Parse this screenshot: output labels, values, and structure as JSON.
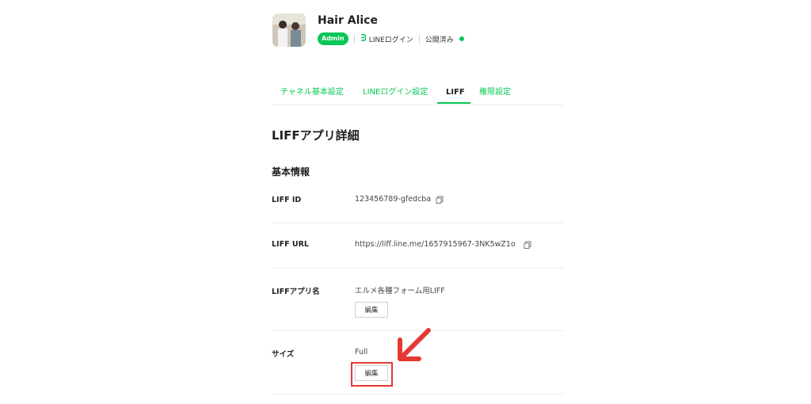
{
  "channel": {
    "name": "Hair Alice",
    "badge": "Admin",
    "type_label": "LINEログイン",
    "status_label": "公開済み",
    "colors": {
      "accent": "#06c755",
      "highlight": "#e53935"
    }
  },
  "tabs": [
    {
      "label": "チャネル基本設定",
      "active": false
    },
    {
      "label": "LINEログイン設定",
      "active": false
    },
    {
      "label": "LIFF",
      "active": true
    },
    {
      "label": "権限設定",
      "active": false
    }
  ],
  "page": {
    "title": "LIFFアプリ詳細",
    "section_title": "基本情報"
  },
  "rows": {
    "liff_id": {
      "label": "LIFF ID",
      "value": "123456789-gfedcba",
      "icon": "copy-icon"
    },
    "liff_url": {
      "label": "LIFF URL",
      "value": "https://liff.line.me/1657915967-3NK5wZ1o",
      "icon": "copy-icon"
    },
    "app_name": {
      "label": "LIFFアプリ名",
      "value": "エルメ各種フォーム用LIFF",
      "edit_label": "編集"
    },
    "size": {
      "label": "サイズ",
      "value": "Full",
      "edit_label": "編集"
    }
  },
  "annotation": {
    "icon": "red-arrow-icon",
    "target": "size-edit-button"
  }
}
